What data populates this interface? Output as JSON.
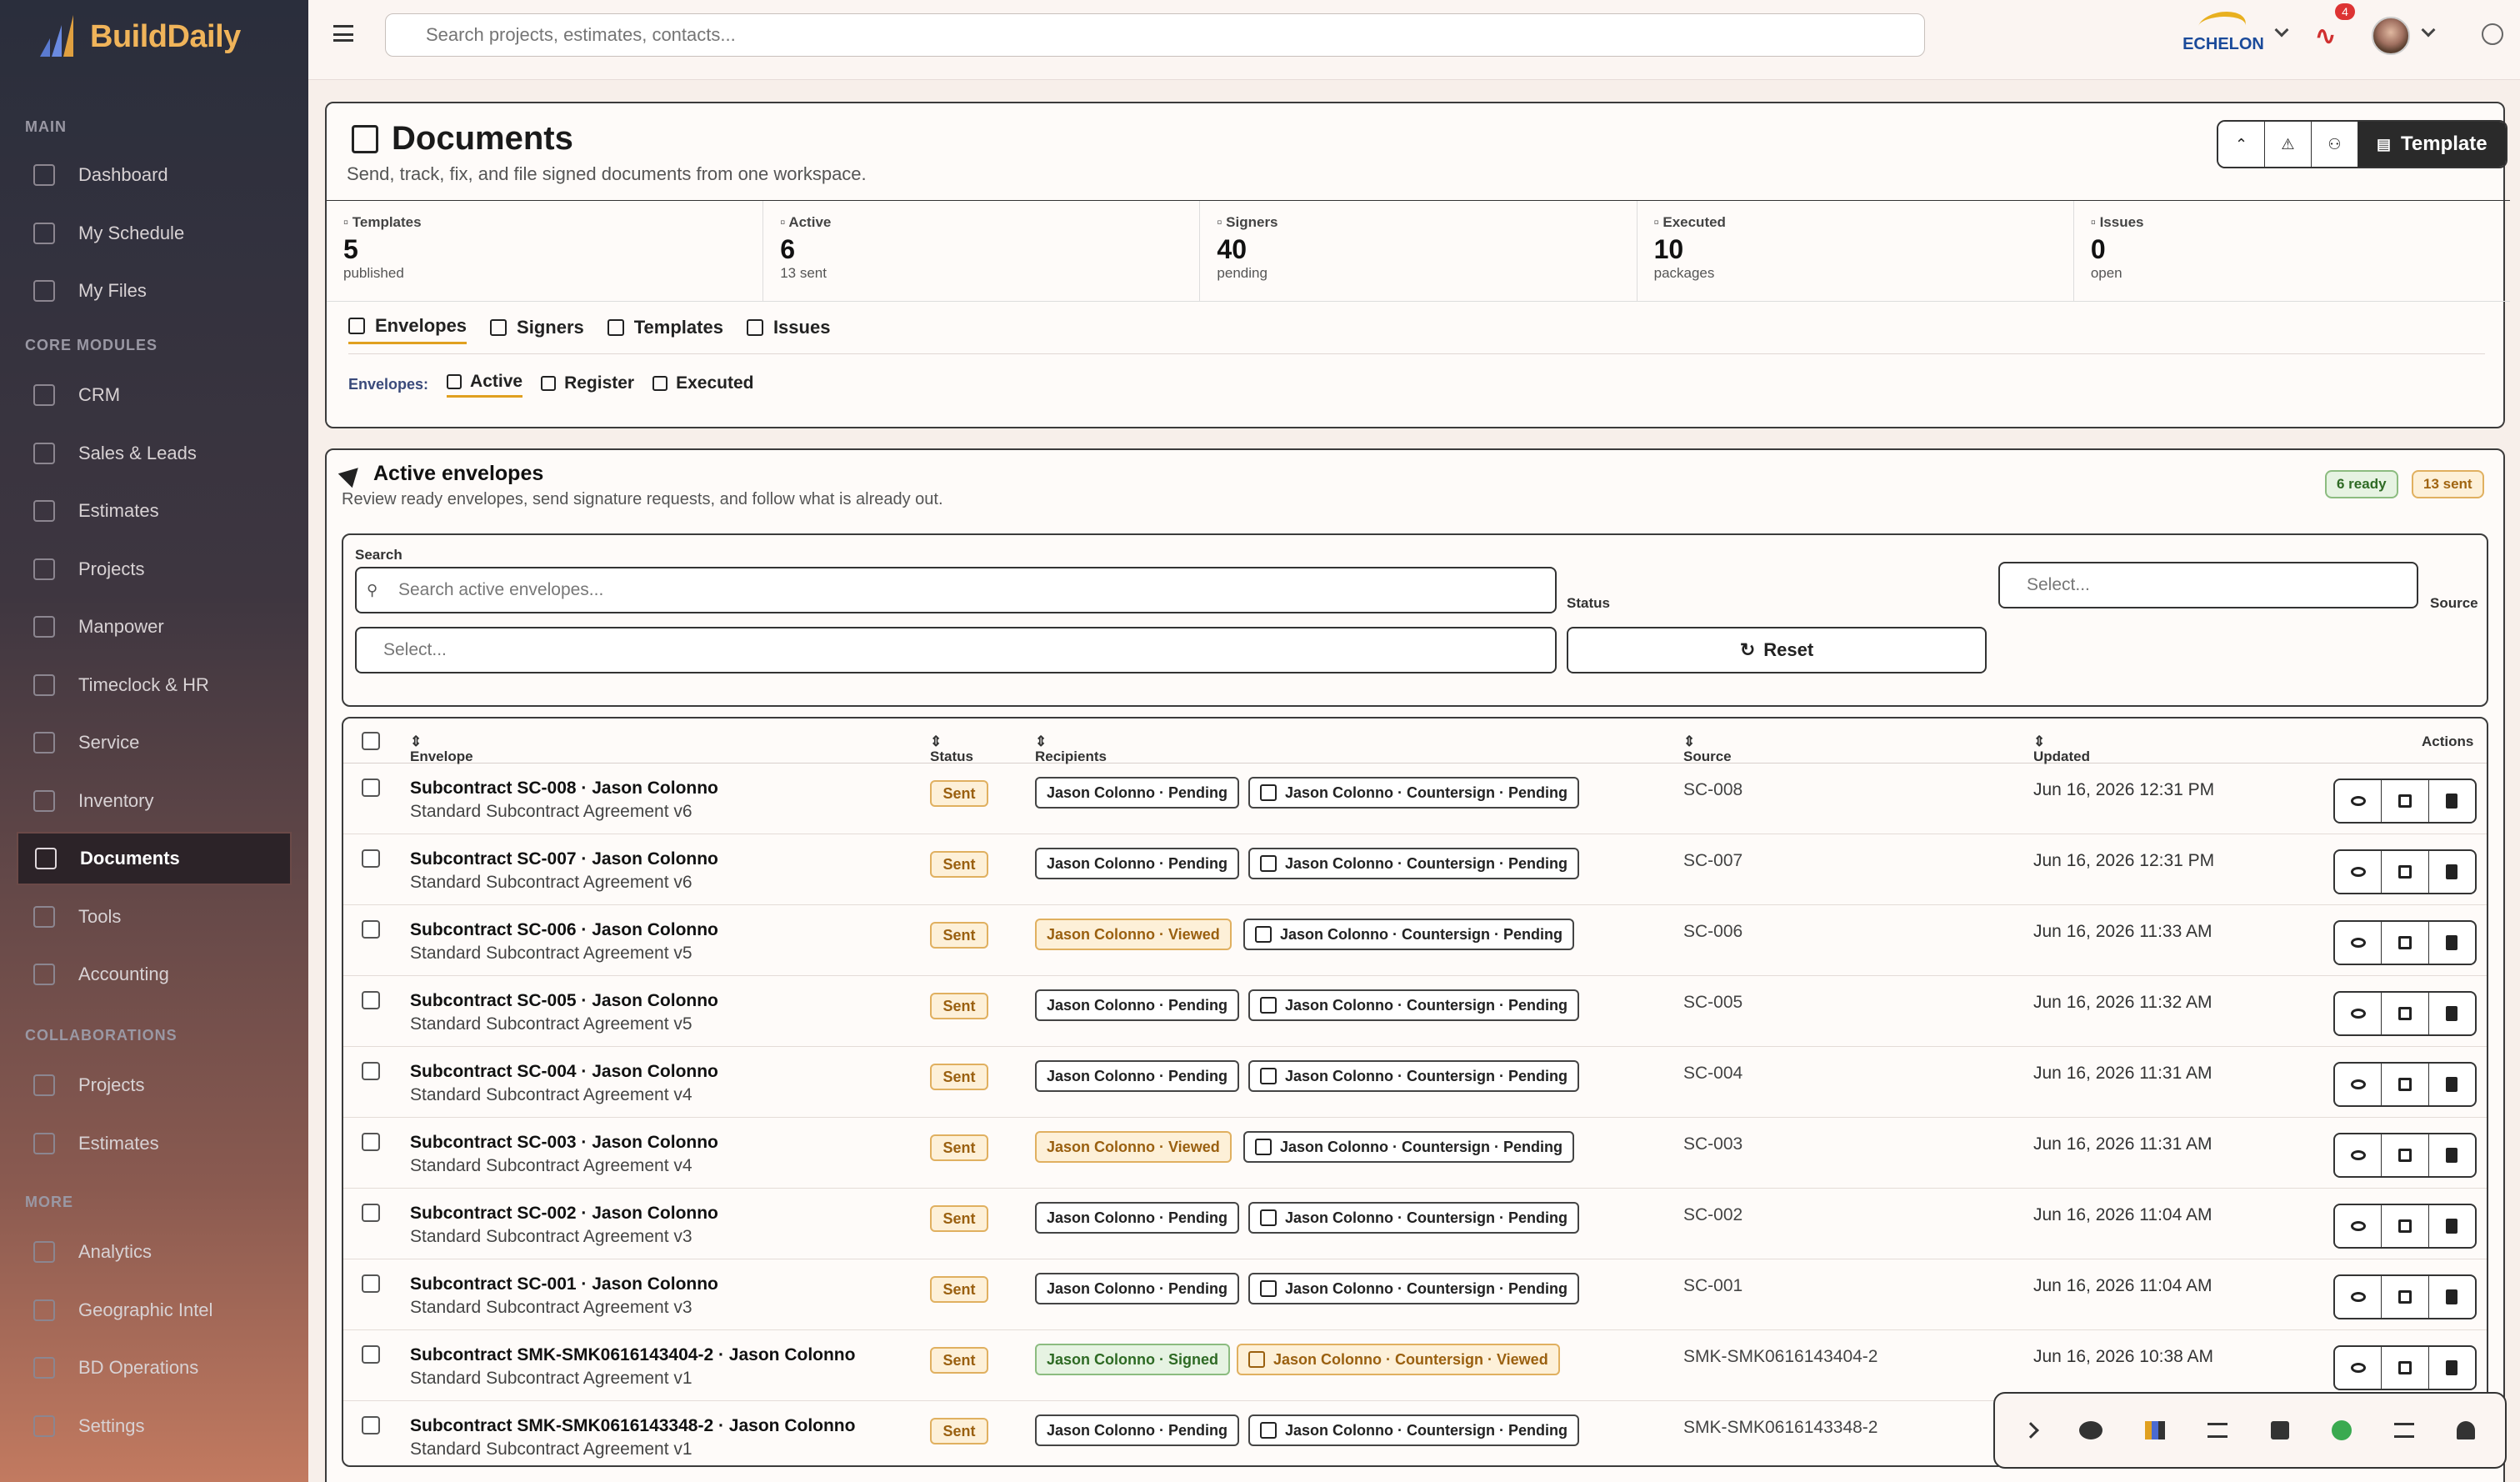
{
  "app": {
    "name": "BuildDaily"
  },
  "sidebar": {
    "sections": [
      {
        "label": "MAIN",
        "items": [
          "Dashboard",
          "My Schedule",
          "My Files"
        ]
      },
      {
        "label": "CORE MODULES",
        "items": [
          "CRM",
          "Sales & Leads",
          "Estimates",
          "Projects",
          "Manpower",
          "Timeclock & HR",
          "Service",
          "Inventory",
          "Documents",
          "Tools",
          "Accounting"
        ]
      },
      {
        "label": "COLLABORATIONS",
        "items": [
          "Projects",
          "Estimates"
        ]
      },
      {
        "label": "MORE",
        "items": [
          "Analytics",
          "Geographic Intel",
          "BD Operations",
          "Settings"
        ]
      }
    ],
    "active": "Documents"
  },
  "topbar": {
    "search_placeholder": "Search projects, estimates, contacts...",
    "company": "ECHELON",
    "notifications": "4"
  },
  "header": {
    "title": "Documents",
    "subtitle": "Send, track, fix, and file signed documents from one workspace.",
    "template_button": "Template"
  },
  "stats": [
    {
      "label": "Templates",
      "value": "5",
      "sub": "published"
    },
    {
      "label": "Active",
      "value": "6",
      "sub": "13 sent"
    },
    {
      "label": "Signers",
      "value": "40",
      "sub": "pending"
    },
    {
      "label": "Executed",
      "value": "10",
      "sub": "packages"
    },
    {
      "label": "Issues",
      "value": "0",
      "sub": "open"
    }
  ],
  "tabs": [
    "Envelopes",
    "Signers",
    "Templates",
    "Issues"
  ],
  "subtabs": {
    "label": "Envelopes:",
    "items": [
      "Active",
      "Register",
      "Executed"
    ]
  },
  "active_envelopes": {
    "title": "Active envelopes",
    "subtitle": "Review ready envelopes, send signature requests, and follow what is already out.",
    "ready_pill": "6 ready",
    "sent_pill": "13 sent"
  },
  "filters": {
    "search_label": "Search",
    "search_placeholder": "Search active envelopes...",
    "status_label": "Status",
    "status_placeholder": "Select...",
    "source_label": "Source",
    "source_placeholder": "Select...",
    "reset_label": "Reset"
  },
  "table": {
    "headers": {
      "envelope": "Envelope",
      "status": "Status",
      "recipients": "Recipients",
      "source": "Source",
      "updated": "Updated",
      "actions": "Actions"
    },
    "rows": [
      {
        "title": "Subcontract SC-008 · Jason Colonno",
        "sub": "Standard Subcontract Agreement v6",
        "status": "Sent",
        "r1": "Jason Colonno · Pending",
        "r1s": "pending",
        "r2": "Jason Colonno · Countersign · Pending",
        "r2s": "pending",
        "source": "SC-008",
        "updated": "Jun 16, 2026 12:31 PM"
      },
      {
        "title": "Subcontract SC-007 · Jason Colonno",
        "sub": "Standard Subcontract Agreement v6",
        "status": "Sent",
        "r1": "Jason Colonno · Pending",
        "r1s": "pending",
        "r2": "Jason Colonno · Countersign · Pending",
        "r2s": "pending",
        "source": "SC-007",
        "updated": "Jun 16, 2026 12:31 PM"
      },
      {
        "title": "Subcontract SC-006 · Jason Colonno",
        "sub": "Standard Subcontract Agreement v5",
        "status": "Sent",
        "r1": "Jason Colonno · Viewed",
        "r1s": "viewed",
        "r2": "Jason Colonno · Countersign · Pending",
        "r2s": "pending",
        "source": "SC-006",
        "updated": "Jun 16, 2026 11:33 AM"
      },
      {
        "title": "Subcontract SC-005 · Jason Colonno",
        "sub": "Standard Subcontract Agreement v5",
        "status": "Sent",
        "r1": "Jason Colonno · Pending",
        "r1s": "pending",
        "r2": "Jason Colonno · Countersign · Pending",
        "r2s": "pending",
        "source": "SC-005",
        "updated": "Jun 16, 2026 11:32 AM"
      },
      {
        "title": "Subcontract SC-004 · Jason Colonno",
        "sub": "Standard Subcontract Agreement v4",
        "status": "Sent",
        "r1": "Jason Colonno · Pending",
        "r1s": "pending",
        "r2": "Jason Colonno · Countersign · Pending",
        "r2s": "pending",
        "source": "SC-004",
        "updated": "Jun 16, 2026 11:31 AM"
      },
      {
        "title": "Subcontract SC-003 · Jason Colonno",
        "sub": "Standard Subcontract Agreement v4",
        "status": "Sent",
        "r1": "Jason Colonno · Viewed",
        "r1s": "viewed",
        "r2": "Jason Colonno · Countersign · Pending",
        "r2s": "pending",
        "source": "SC-003",
        "updated": "Jun 16, 2026 11:31 AM"
      },
      {
        "title": "Subcontract SC-002 · Jason Colonno",
        "sub": "Standard Subcontract Agreement v3",
        "status": "Sent",
        "r1": "Jason Colonno · Pending",
        "r1s": "pending",
        "r2": "Jason Colonno · Countersign · Pending",
        "r2s": "pending",
        "source": "SC-002",
        "updated": "Jun 16, 2026 11:04 AM"
      },
      {
        "title": "Subcontract SC-001 · Jason Colonno",
        "sub": "Standard Subcontract Agreement v3",
        "status": "Sent",
        "r1": "Jason Colonno · Pending",
        "r1s": "pending",
        "r2": "Jason Colonno · Countersign · Pending",
        "r2s": "pending",
        "source": "SC-001",
        "updated": "Jun 16, 2026 11:04 AM"
      },
      {
        "title": "Subcontract SMK-SMK0616143404-2 · Jason Colonno",
        "sub": "Standard Subcontract Agreement v1",
        "status": "Sent",
        "r1": "Jason Colonno · Signed",
        "r1s": "signed",
        "r2": "Jason Colonno · Countersign · Viewed",
        "r2s": "viewed",
        "source": "SMK-SMK0616143404-2",
        "updated": "Jun 16, 2026 10:38 AM"
      },
      {
        "title": "Subcontract SMK-SMK0616143348-2 · Jason Colonno",
        "sub": "Standard Subcontract Agreement v1",
        "status": "Sent",
        "r1": "Jason Colonno · Pending",
        "r1s": "pending",
        "r2": "Jason Colonno · Countersign · Pending",
        "r2s": "pending",
        "source": "SMK-SMK0616143348-2",
        "updated": ""
      }
    ]
  },
  "colors": {
    "accent": "#e0a020",
    "sent": "#fdf0d8",
    "signed": "#e6f3e2"
  }
}
